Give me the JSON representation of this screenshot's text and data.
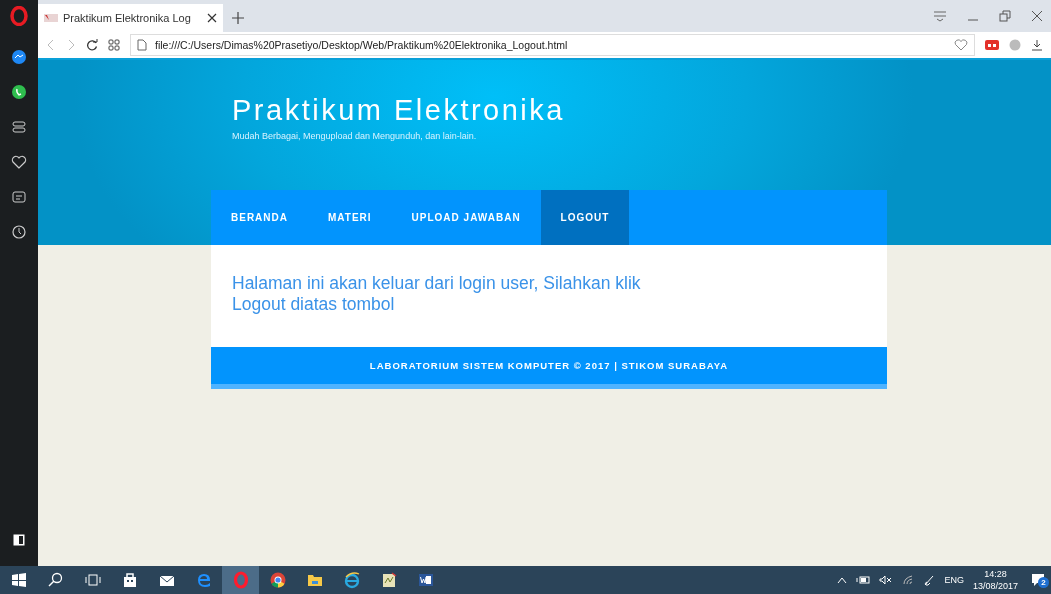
{
  "browser": {
    "tab": {
      "title": "Praktikum Elektronika Log",
      "selected": true
    },
    "address": "file:///C:/Users/Dimas%20Prasetiyo/Desktop/Web/Praktikum%20Elektronika_Logout.html"
  },
  "sidebar": {
    "items": [
      {
        "kind": "messenger"
      },
      {
        "kind": "whatsapp"
      },
      {
        "kind": "speed-dial"
      },
      {
        "kind": "bookmarks"
      },
      {
        "kind": "news"
      },
      {
        "kind": "history"
      }
    ]
  },
  "site": {
    "title": "Praktikum Elektronika",
    "tagline": "Mudah Berbagai, Mengupload dan Mengunduh, dan lain-lain.",
    "nav": [
      {
        "label": "BERANDA",
        "selected": false
      },
      {
        "label": "MATERI",
        "selected": false
      },
      {
        "label": "UPLOAD JAWABAN",
        "selected": false
      },
      {
        "label": "LOGOUT",
        "selected": true
      }
    ],
    "message": "Halaman ini akan keluar dari login user, Silahkan klik Logout diatas tombol",
    "footer": "LABORATORIUM SISTEM KOMPUTER © 2017 | STIKOM SURABAYA"
  },
  "taskbar": {
    "apps": [
      {
        "kind": "start",
        "selected": false
      },
      {
        "kind": "search",
        "selected": false
      },
      {
        "kind": "task-view",
        "selected": false
      },
      {
        "kind": "store",
        "selected": false
      },
      {
        "kind": "mail",
        "selected": false
      },
      {
        "kind": "edge",
        "selected": false
      },
      {
        "kind": "opera",
        "selected": true
      },
      {
        "kind": "chrome",
        "selected": false
      },
      {
        "kind": "explorer",
        "selected": false
      },
      {
        "kind": "ie",
        "selected": false
      },
      {
        "kind": "notepad",
        "selected": false
      },
      {
        "kind": "word",
        "selected": false
      }
    ],
    "language": "ENG",
    "time": "14:28",
    "date": "13/08/2017",
    "notifications": "2"
  }
}
